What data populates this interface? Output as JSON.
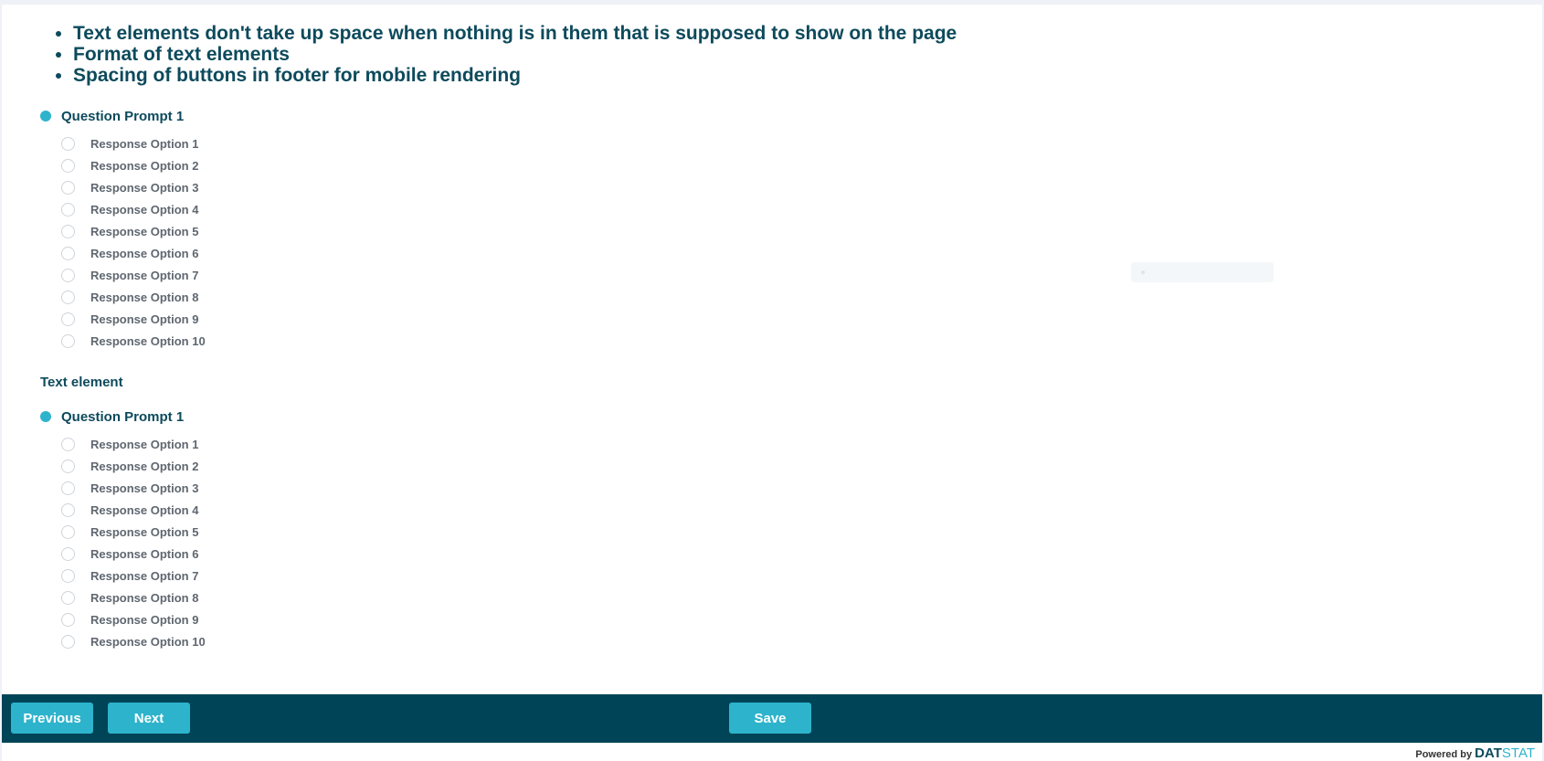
{
  "notes": [
    "Text elements don't take up space when nothing is in them that is supposed to show on the page",
    "Format of text elements",
    "Spacing of buttons in footer for mobile rendering"
  ],
  "question1": {
    "prompt": "Question Prompt 1",
    "options": [
      "Response Option 1",
      "Response Option 2",
      "Response Option 3",
      "Response Option 4",
      "Response Option 5",
      "Response Option 6",
      "Response Option 7",
      "Response Option 8",
      "Response Option 9",
      "Response Option 10"
    ]
  },
  "text_element": "Text element",
  "question2": {
    "prompt": "Question Prompt 1",
    "options": [
      "Response Option 1",
      "Response Option 2",
      "Response Option 3",
      "Response Option 4",
      "Response Option 5",
      "Response Option 6",
      "Response Option 7",
      "Response Option 8",
      "Response Option 9",
      "Response Option 10"
    ]
  },
  "footer": {
    "previous_label": "Previous",
    "next_label": "Next",
    "save_label": "Save"
  },
  "powered_by": {
    "text": "Powered by",
    "brand_a": "DAT",
    "brand_b": "STAT"
  },
  "colors": {
    "accent": "#2eb3cc",
    "footer_bg": "#004457",
    "heading": "#0d4a5c"
  }
}
